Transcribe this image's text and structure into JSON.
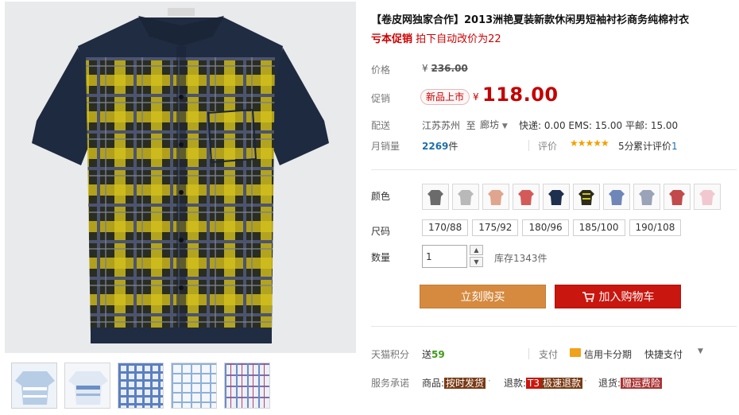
{
  "product": {
    "title": "【卷皮网独家合作】2013洲艳夏装新款休闲男短袖衬衫商务纯棉衬衣",
    "promo_prefix": "亏本促销",
    "promo_text": " 拍下自动改价为22",
    "images": {
      "main": "plaid-shirt-main-image",
      "thumbnails": [
        "thumb-light-blue-shirt",
        "thumb-white-blue-stripe-shirt",
        "thumb-blue-check-fabric",
        "thumb-light-check-fabric",
        "thumb-purple-check-fabric"
      ]
    }
  },
  "price": {
    "original_label": "价格",
    "original_currency": "¥",
    "original_value": "236.00",
    "promo_label": "促销",
    "badge": "新品上市",
    "currency": "¥",
    "value": "118.00"
  },
  "shipping": {
    "label": "配送",
    "from": "江苏苏州",
    "to_word": "至",
    "to": "廊坊",
    "fees": "快递: 0.00 EMS: 15.00 平邮: 15.00"
  },
  "sales": {
    "label": "月销量",
    "count": "2269",
    "unit": "件",
    "rating_label": "评价",
    "stars": "★★★★★",
    "score": "5分",
    "reviews_prefix": "累计评价",
    "reviews_count": "1"
  },
  "colors": {
    "label": "颜色",
    "swatches": [
      {
        "color": "#6b6b6b"
      },
      {
        "color": "#b9b9b9"
      },
      {
        "color": "#e0a58f"
      },
      {
        "color": "#d45a5a"
      },
      {
        "color": "#1f2f4e"
      },
      {
        "color": "#2c2d1a"
      },
      {
        "color": "#6f86b8"
      },
      {
        "color": "#9aa3b8"
      },
      {
        "color": "#c24a4a"
      },
      {
        "color": "#f2c8d0"
      }
    ]
  },
  "sizes": {
    "label": "尺码",
    "options": [
      "170/88",
      "175/92",
      "180/96",
      "185/100",
      "190/108"
    ]
  },
  "quantity": {
    "label": "数量",
    "value": "1",
    "stock": "库存1343件"
  },
  "buttons": {
    "buy_now": "立刻购买",
    "add_to_cart": "加入购物车"
  },
  "points": {
    "label": "天猫积分",
    "prefix": "送",
    "value": "59"
  },
  "payment": {
    "label": "支付",
    "credit_card": "信用卡分期",
    "quick_pay": "快捷支付"
  },
  "services": {
    "label": "服务承诺",
    "goods_prefix": "商品:",
    "goods_tag": "按时发货",
    "refund_prefix": "退款:",
    "refund_tag_1": "T3",
    "refund_tag_2": "极速退款",
    "return_prefix": "退货:",
    "return_tag": "赠运费险"
  },
  "theme": {
    "accent_red": "#c40000",
    "buy_button": "#d58a3f",
    "cart_button": "#c9160e",
    "link_blue": "#1e6fa8"
  }
}
